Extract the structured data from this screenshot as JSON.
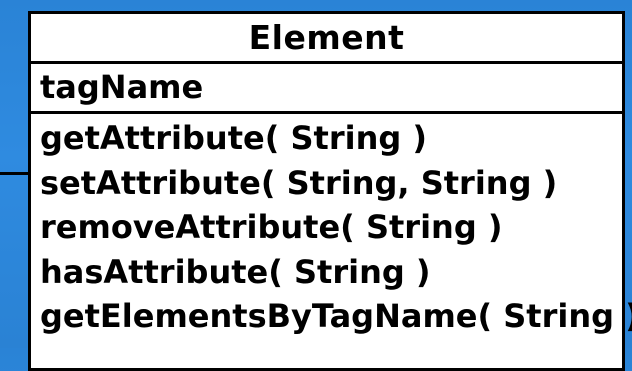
{
  "class_name": "Element",
  "attributes": [
    "tagName"
  ],
  "methods": [
    "getAttribute( String )",
    "setAttribute( String, String )",
    "removeAttribute( String )",
    "hasAttribute( String )",
    "getElementsByTagName( String )"
  ]
}
